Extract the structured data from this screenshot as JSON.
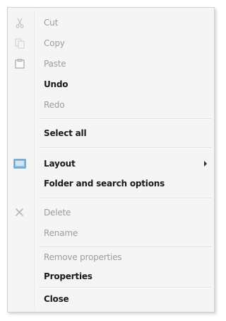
{
  "menu": {
    "items": [
      {
        "label": "Cut",
        "enabled": false,
        "icon": "scissors-icon"
      },
      {
        "label": "Copy",
        "enabled": false,
        "icon": "copy-icon"
      },
      {
        "label": "Paste",
        "enabled": false,
        "icon": "paste-icon"
      },
      {
        "label": "Undo",
        "enabled": true
      },
      {
        "label": "Redo",
        "enabled": false
      },
      {
        "label": "Select all",
        "enabled": true
      },
      {
        "label": "Layout",
        "enabled": true,
        "icon": "layout-icon",
        "submenu": true
      },
      {
        "label": "Folder and search options",
        "enabled": true
      },
      {
        "label": "Delete",
        "enabled": false,
        "icon": "delete-icon"
      },
      {
        "label": "Rename",
        "enabled": false
      },
      {
        "label": "Remove properties",
        "enabled": false
      },
      {
        "label": "Properties",
        "enabled": true
      },
      {
        "label": "Close",
        "enabled": true
      }
    ]
  },
  "colors": {
    "menu_background": "#f5f5f5",
    "enabled_text": "#1a1a1a",
    "disabled_text": "#9c9c9c",
    "layout_icon": "#4a90c8"
  }
}
